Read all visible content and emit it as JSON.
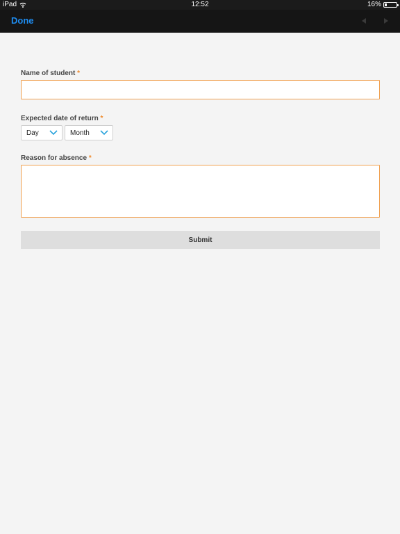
{
  "status_bar": {
    "device": "iPad",
    "time": "12:52",
    "battery": "16%",
    "battery_level": 0.16
  },
  "nav": {
    "done_label": "Done",
    "prev_icon": "prev-arrow-icon",
    "next_icon": "next-arrow-icon"
  },
  "form": {
    "student_label": "Name of student",
    "required_mark": "*",
    "student_value": "",
    "return_label": "Expected date of return",
    "day_select": "Day",
    "month_select": "Month",
    "reason_label": "Reason for absence",
    "reason_value": "",
    "submit_label": "Submit"
  },
  "colors": {
    "accent": "#1e8cf0",
    "required": "#ef8a2c",
    "input_border": "#f0a050",
    "chevron": "#2aa3dc"
  }
}
